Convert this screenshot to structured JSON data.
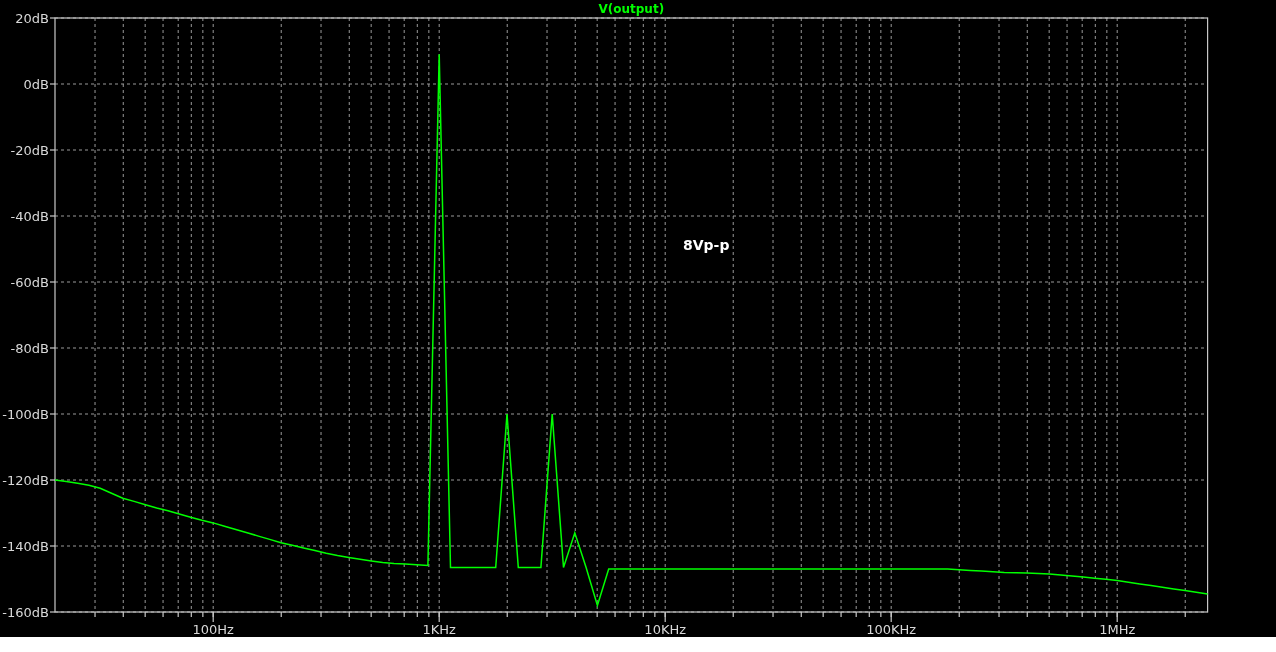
{
  "plot": {
    "chart_data": {
      "type": "line",
      "grid": true,
      "ylim": [
        -160,
        20
      ],
      "categories": [
        null,
        null,
        null,
        null,
        null,
        null,
        null,
        null,
        null,
        null,
        null,
        null,
        null,
        null,
        "100Hz",
        null,
        null,
        null,
        null,
        null,
        null,
        null,
        null,
        null,
        null,
        null,
        null,
        null,
        null,
        null,
        null,
        null,
        null,
        null,
        "1KHz",
        null,
        null,
        null,
        null,
        null,
        null,
        null,
        null,
        null,
        null,
        null,
        null,
        null,
        null,
        null,
        null,
        null,
        null,
        null,
        "10KHz",
        null,
        null,
        null,
        null,
        null,
        null,
        null,
        null,
        null,
        null,
        null,
        null,
        null,
        null,
        null,
        null,
        null,
        null,
        null,
        "100KHz",
        null,
        null,
        null,
        null,
        null,
        null,
        null,
        null,
        null,
        null,
        null,
        null,
        null,
        null,
        null,
        null,
        null,
        null,
        null,
        "1MHz",
        null,
        null,
        null,
        null,
        null,
        null,
        null,
        null
      ],
      "yticks": [
        {
          "value": 20,
          "label": "20dB"
        },
        {
          "value": 0,
          "label": "0dB"
        },
        {
          "value": -20,
          "label": "-20dB"
        },
        {
          "value": -40,
          "label": "-40dB"
        },
        {
          "value": -60,
          "label": "-60dB"
        },
        {
          "value": -80,
          "label": "-80dB"
        },
        {
          "value": -100,
          "label": "-100dB"
        },
        {
          "value": -120,
          "label": "-120dB"
        },
        {
          "value": -140,
          "label": "-140dB"
        },
        {
          "value": -160,
          "label": "-160dB"
        }
      ],
      "series": [
        {
          "name": "V(output)",
          "color": "#00ff00",
          "values": [
            -120,
            -120.5,
            -121,
            -121.6,
            -122.5,
            -124,
            -125.5,
            -126.5,
            -127.5,
            -128.5,
            -129.3,
            -130.3,
            -131.3,
            -132.2,
            -133,
            -134,
            -135,
            -136,
            -137,
            -138,
            -139,
            -139.8,
            -140.6,
            -141.4,
            -142.2,
            -142.9,
            -143.5,
            -144,
            -144.5,
            -145,
            -145.3,
            -145.5,
            -145.7,
            -145.9,
            9,
            -146.5,
            -146.5,
            -146.5,
            -146.5,
            -146.5,
            -100,
            -146.5,
            -146.5,
            -146.5,
            -100,
            -146.5,
            -136,
            -146.5,
            -158,
            -147,
            -147,
            -147,
            -147,
            -147,
            -147,
            -147,
            -147,
            -147,
            -147,
            -147,
            -147,
            -147,
            -147,
            -147,
            -147,
            -147,
            -147,
            -147,
            -147,
            -147,
            -147,
            -147,
            -147,
            -147,
            -147,
            -147,
            -147,
            -147,
            -147,
            -147,
            -147.2,
            -147.4,
            -147.6,
            -147.8,
            -148,
            -148.1,
            -148.2,
            -148.3,
            -148.5,
            -148.8,
            -149.1,
            -149.4,
            -149.8,
            -150.1,
            -150.5,
            -151,
            -151.5,
            -152,
            -152.5,
            -153,
            -153.5,
            -154,
            -154.5
          ]
        }
      ],
      "annotations": [
        "8Vp-p"
      ]
    }
  }
}
